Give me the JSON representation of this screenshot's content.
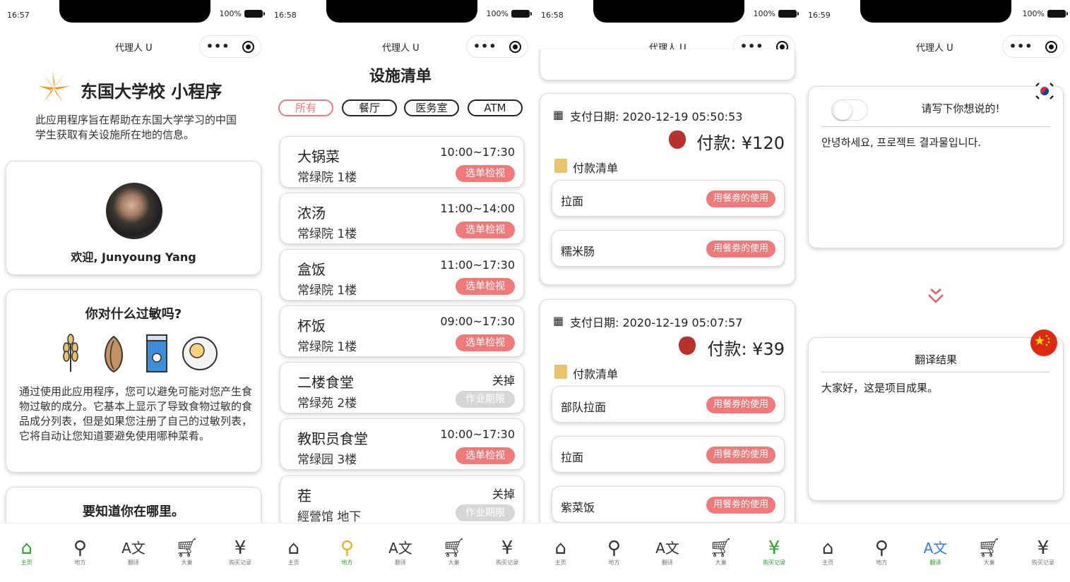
{
  "screens": [
    {
      "time": "16:57",
      "battery": "100%",
      "nav_title": "代理人 U"
    },
    {
      "time": "16:58",
      "battery": "100%",
      "nav_title": "代理人 U"
    },
    {
      "time": "16:58",
      "battery": "100%",
      "nav_title": "代理人 U"
    },
    {
      "time": "16:59",
      "battery": "100%",
      "nav_title": "代理人 U"
    }
  ],
  "home": {
    "title": "东国大学校 小程序",
    "intro": "此应用程序旨在帮助在东国大学学习的中国学生获取有关设施所在地的信息。",
    "welcome": "欢迎, Junyoung Yang",
    "allergy_title": "你对什么过敏吗?",
    "allergy_text": "通过使用此应用程序，您可以避免可能对您产生食物过敏的成分。它基本上显示了导致食物过敏的食品成分列表，但是如果您注册了自己的过敏列表，它将自动让您知道要避免使用哪种菜肴。",
    "location_title": "要知道你在哪里。"
  },
  "facilities": {
    "title": "设施清单",
    "filters": [
      "所有",
      "餐厅",
      "医务室",
      "ATM"
    ],
    "items": [
      {
        "name": "大锅菜",
        "location": "常绿院 1楼",
        "hours": "10:00~17:30",
        "button": "选单检视",
        "open": true
      },
      {
        "name": "浓汤",
        "location": "常绿院 1楼",
        "hours": "11:00~14:00",
        "button": "选单检视",
        "open": true
      },
      {
        "name": "盒饭",
        "location": "常绿院 1楼",
        "hours": "11:00~17:30",
        "button": "选单检视",
        "open": true
      },
      {
        "name": "杯饭",
        "location": "常绿院 1楼",
        "hours": "09:00~17:30",
        "button": "选单检视",
        "open": true
      },
      {
        "name": "二楼食堂",
        "location": "常绿苑 2楼",
        "hours": "关掉",
        "button": "作业期限",
        "open": false
      },
      {
        "name": "教职员食堂",
        "location": "常绿园 3楼",
        "hours": "10:00~17:30",
        "button": "选单检视",
        "open": true
      },
      {
        "name": "茬",
        "location": "經營馆 地下",
        "hours": "关掉",
        "button": "作业期限",
        "open": false
      }
    ]
  },
  "payments": {
    "list_label": "付款清单",
    "coupon_button": "用餐劵的使用",
    "records": [
      {
        "date": "支付日期: 2020-12-19 05:50:53",
        "amount": "付款: ¥120",
        "items": [
          "拉面",
          "糯米肠"
        ]
      },
      {
        "date": "支付日期: 2020-12-19 05:07:57",
        "amount": "付款: ¥39",
        "items": [
          "部队拉面",
          "拉面",
          "紫菜饭"
        ]
      }
    ]
  },
  "translate": {
    "prompt": "请写下你想说的!",
    "input_text": "안녕하세요, 프로젝트 결과물입니다.",
    "result_title": "翻译结果",
    "result_text": "大家好，这是项目成果。"
  },
  "tabs": [
    {
      "label": "主页",
      "icon": "home-icon"
    },
    {
      "label": "地方",
      "icon": "location-icon"
    },
    {
      "label": "翻译",
      "icon": "translate-icon"
    },
    {
      "label": "大巢",
      "icon": "cart-icon"
    },
    {
      "label": "购买记录",
      "icon": "receipt-icon"
    }
  ],
  "colors": {
    "accent_red": "#f07a7a",
    "active_green": "#2aa52e",
    "filter_active": "#f07a7a"
  }
}
